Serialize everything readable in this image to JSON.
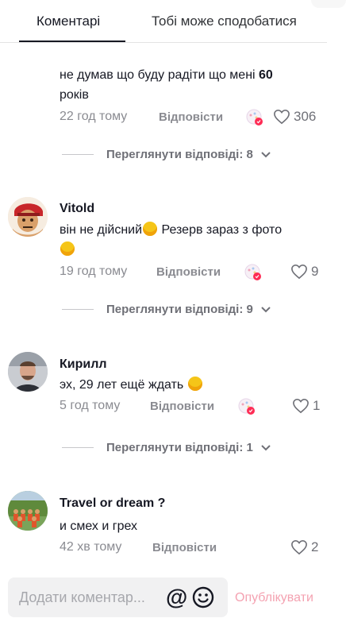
{
  "tabs": {
    "comments": "Коментарі",
    "suggested": "Тобі може сподобатися"
  },
  "comments": [
    {
      "username": "",
      "text_pre": "не думав що буду радіти що мені ",
      "text_bold": "60",
      "text_post": " років",
      "time": "22 год тому",
      "reply": "Відповісти",
      "likes": "306",
      "view_replies": "Переглянути відповіді: 8"
    },
    {
      "username": "Vitold",
      "text_pre": "він не дійсний",
      "text_post": " Резерв зараз з фото",
      "time": "19 год тому",
      "reply": "Відповісти",
      "likes": "9",
      "view_replies": "Переглянути відповіді: 9"
    },
    {
      "username": "Кирилл",
      "text_pre": "эх, 29 лет ещё ждать",
      "time": "5 год тому",
      "reply": "Відповісти",
      "likes": "1",
      "view_replies": "Переглянути відповіді: 1"
    },
    {
      "username": "Travel or dream ?",
      "text_pre": "и смех и грех",
      "time": "42 хв тому",
      "reply": "Відповісти",
      "likes": "2"
    }
  ],
  "input": {
    "placeholder": "Додати коментар...",
    "publish": "Опублікувати"
  },
  "icons": {
    "like": "heart-outline-icon",
    "creator_liked": "creator-liked-badge",
    "mention": "at-icon",
    "emoji": "smile-icon",
    "expand": "chevron-down-icon"
  },
  "colors": {
    "accent_publish": "#f4a2b1",
    "text_primary": "#161823",
    "text_secondary": "#8a8b91"
  }
}
